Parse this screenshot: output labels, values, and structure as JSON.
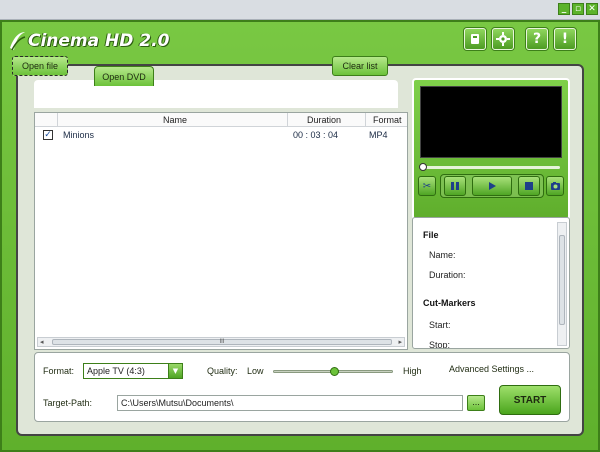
{
  "window": {
    "buttons": [
      "_",
      "▫",
      "✕"
    ]
  },
  "app": {
    "title": "Cinema HD 2.0"
  },
  "header_buttons": [
    {
      "name": "settings-icon"
    },
    {
      "name": "gear-icon"
    },
    {
      "label": "?"
    },
    {
      "label": "!"
    }
  ],
  "toolbar": {
    "open_file": "Open file",
    "open_dvd": "Open DVD",
    "clear_list": "Clear list"
  },
  "file_list": {
    "columns": [
      "Name",
      "Duration",
      "Format"
    ],
    "rows": [
      {
        "checked": true,
        "name": "Minions",
        "duration": "00 : 03 : 04",
        "format": "MP4"
      }
    ]
  },
  "info": {
    "file_heading": "File",
    "name_label": "Name:",
    "duration_label": "Duration:",
    "cut_heading": "Cut-Markers",
    "start_label": "Start:",
    "stop_label": "Stop:"
  },
  "settings": {
    "format_label": "Format:",
    "format_value": "Apple TV (4:3)",
    "quality_label": "Quality:",
    "quality_low": "Low",
    "quality_high": "High",
    "quality_value": 0.5,
    "advanced": "Advanced Settings ...",
    "target_label": "Target-Path:",
    "target_value": "C:\\Users\\Mutsu\\Documents\\",
    "browse": "...",
    "start": "START"
  },
  "colors": {
    "accent": "#6fbf3a",
    "dark": "#3d7f19"
  }
}
